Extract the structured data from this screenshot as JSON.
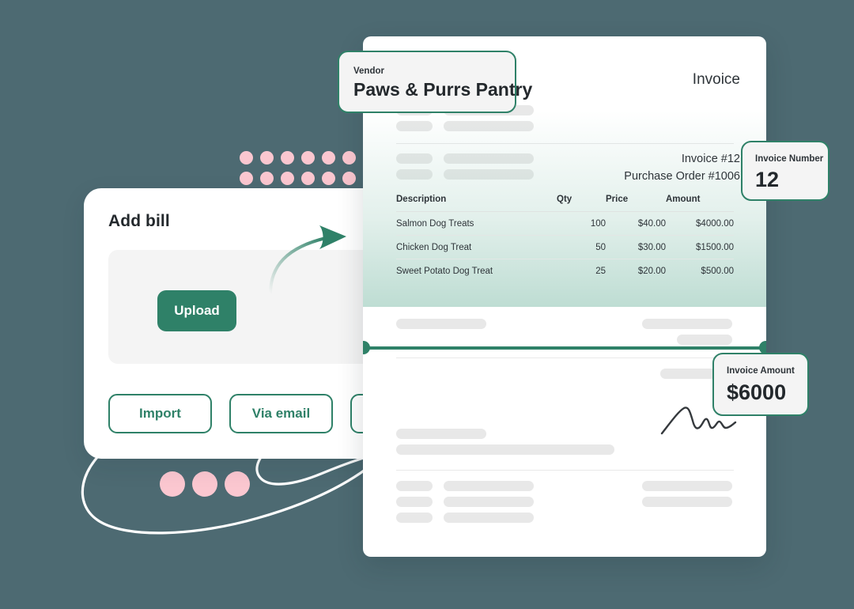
{
  "theme": {
    "background": "#4d6a72",
    "accent_green": "#2f8168",
    "pink": "#fbc7d0",
    "card_white": "#ffffff",
    "skeleton_gray": "#e8e8e8",
    "dropzone_gray": "#f4f4f4"
  },
  "add_bill_card": {
    "title": "Add bill",
    "upload_button": "Upload",
    "actions": [
      {
        "label": "Import"
      },
      {
        "label": "Via email"
      },
      {
        "label": ""
      }
    ]
  },
  "invoice": {
    "heading": "Invoice",
    "invoice_line": "Invoice #12",
    "purchase_order_line": "Purchase Order #1006",
    "table": {
      "columns": [
        "Description",
        "Qty",
        "Price",
        "Amount"
      ],
      "rows": [
        {
          "description": "Salmon Dog Treats",
          "qty": "100",
          "price": "$40.00",
          "amount": "$4000.00"
        },
        {
          "description": "Chicken Dog Treat",
          "qty": "50",
          "price": "$30.00",
          "amount": "$1500.00"
        },
        {
          "description": "Sweet Potato Dog Treat",
          "qty": "25",
          "price": "$20.00",
          "amount": "$500.00"
        }
      ]
    }
  },
  "callouts": {
    "vendor": {
      "label": "Vendor",
      "value": "Paws & Purrs Pantry"
    },
    "invoice_number": {
      "label": "Invoice Number",
      "value": "12"
    },
    "invoice_amount": {
      "label": "Invoice Amount",
      "value": "$6000"
    }
  },
  "decor": {
    "dot_grid_columns": 7,
    "dot_grid_rows": 3,
    "pink_circle_count": 3
  }
}
